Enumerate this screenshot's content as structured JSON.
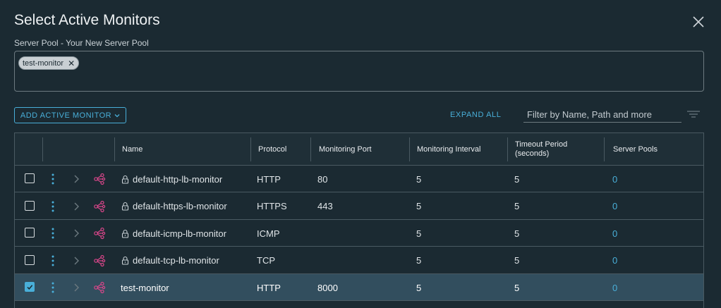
{
  "dialog": {
    "title": "Select Active Monitors",
    "pool_label": "Server Pool - Your New Server Pool",
    "selected_tags": [
      {
        "label": "test-monitor"
      }
    ]
  },
  "toolbar": {
    "add_label": "ADD ACTIVE MONITOR",
    "expand_all_label": "EXPAND ALL",
    "filter_placeholder": "Filter by Name, Path and more"
  },
  "table": {
    "columns": {
      "name": "Name",
      "protocol": "Protocol",
      "port": "Monitoring Port",
      "interval": "Monitoring Interval",
      "timeout_line1": "Timeout Period",
      "timeout_line2": "(seconds)",
      "pools": "Server Pools"
    },
    "rows": [
      {
        "name": "default-http-lb-monitor",
        "locked": true,
        "protocol": "HTTP",
        "port": "80",
        "interval": "5",
        "timeout": "5",
        "pools": "0",
        "checked": false
      },
      {
        "name": "default-https-lb-monitor",
        "locked": true,
        "protocol": "HTTPS",
        "port": "443",
        "interval": "5",
        "timeout": "5",
        "pools": "0",
        "checked": false
      },
      {
        "name": "default-icmp-lb-monitor",
        "locked": true,
        "protocol": "ICMP",
        "port": "",
        "interval": "5",
        "timeout": "5",
        "pools": "0",
        "checked": false
      },
      {
        "name": "default-tcp-lb-monitor",
        "locked": true,
        "protocol": "TCP",
        "port": "",
        "interval": "5",
        "timeout": "5",
        "pools": "0",
        "checked": false
      },
      {
        "name": "test-monitor",
        "locked": false,
        "protocol": "HTTP",
        "port": "8000",
        "interval": "5",
        "timeout": "5",
        "pools": "0",
        "checked": true
      }
    ]
  },
  "colors": {
    "background": "#1b2a32",
    "accent": "#49afd9",
    "selected_row": "#324e5e",
    "monitor_icon": "#d9468a"
  },
  "icons": [
    "close-icon",
    "remove-tag-icon",
    "chevron-down-icon",
    "filter-icon",
    "kebab-icon",
    "chevron-right-icon",
    "monitor-graph-icon",
    "lock-icon",
    "check-icon"
  ]
}
